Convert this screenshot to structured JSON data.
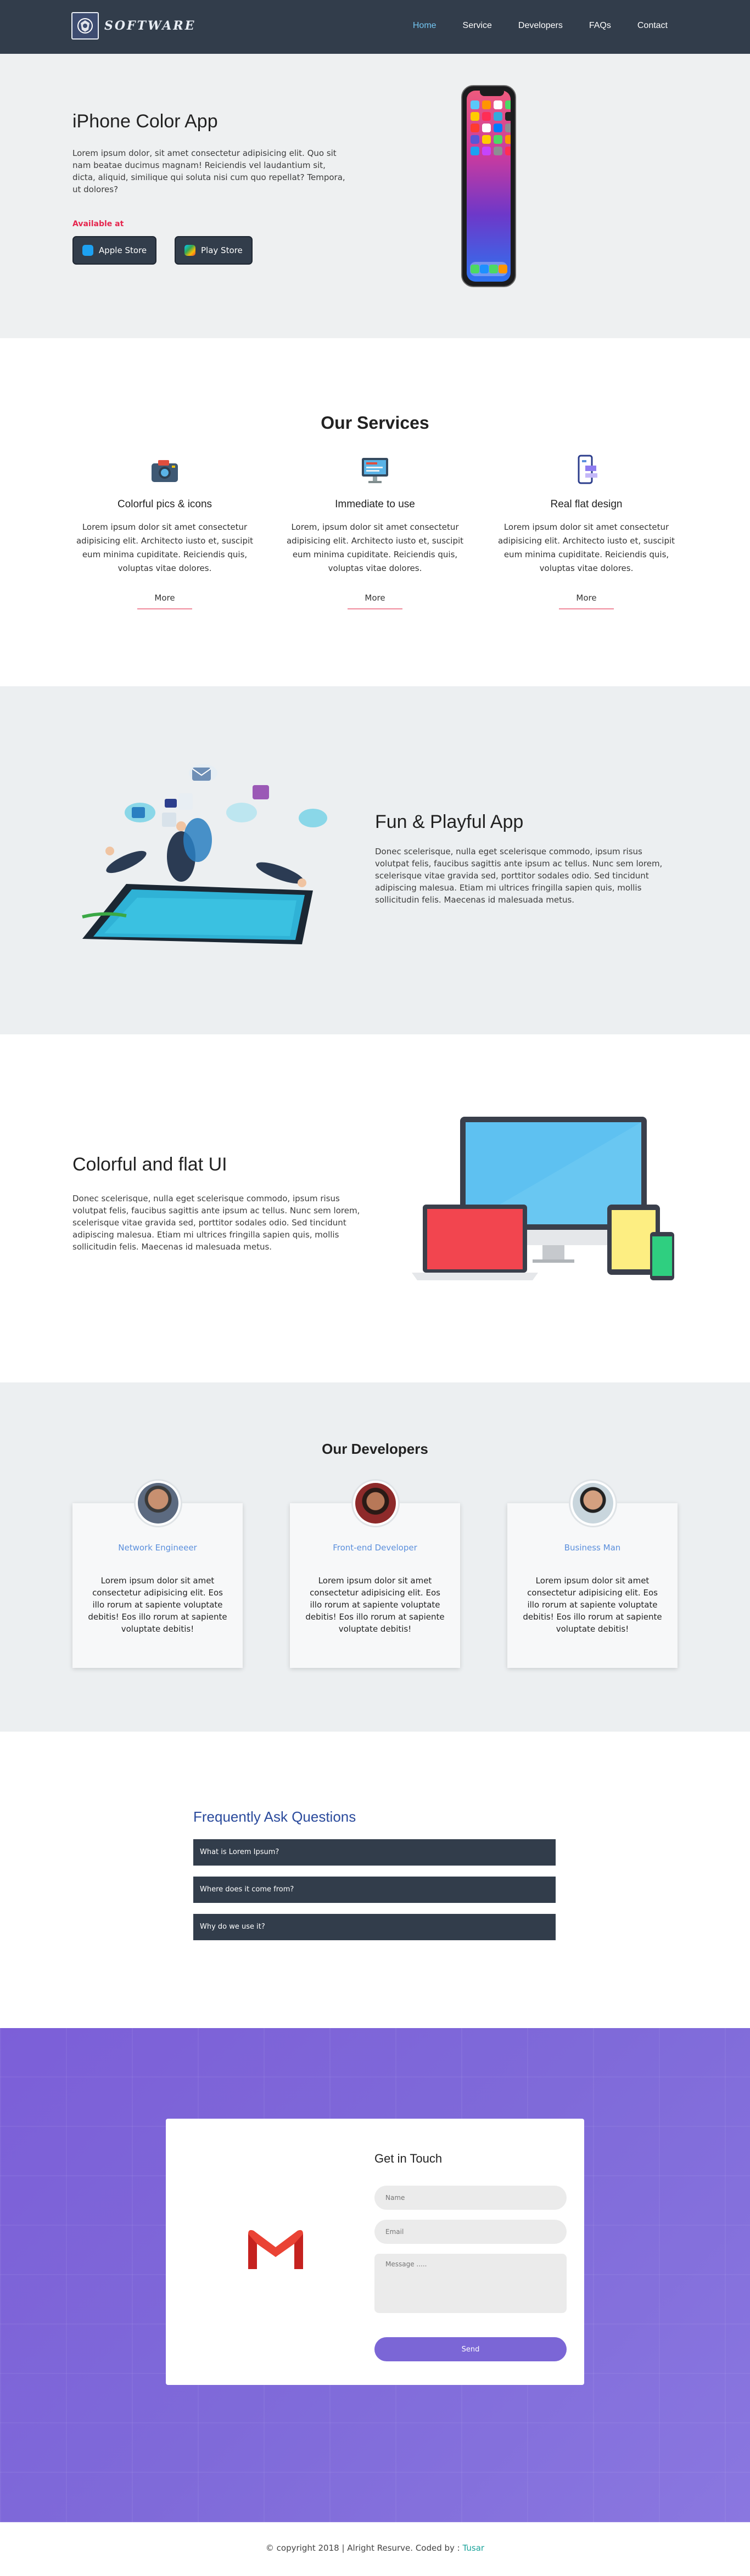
{
  "nav": {
    "logo_text": "SOFTWARE",
    "items": [
      {
        "label": "Home"
      },
      {
        "label": "Service"
      },
      {
        "label": "Developers"
      },
      {
        "label": "FAQs"
      },
      {
        "label": "Contact"
      }
    ]
  },
  "hero": {
    "title": "iPhone Color App",
    "text": "Lorem ipsum dolor, sit amet consectetur adipisicing elit. Quo sit nam beatae ducimus magnam! Reiciendis vel laudantium sit, dicta, aliquid, similique qui soluta nisi cum quo repellat? Tempora, ut dolores?",
    "available": "Available at",
    "apple_label": "Apple Store",
    "play_label": "Play Store"
  },
  "services": {
    "title": "Our Services",
    "items": [
      {
        "title": "Colorful pics & icons",
        "text": "Lorem ipsum dolor sit amet consectetur adipisicing elit. Architecto iusto et, suscipit eum minima cupiditate. Reiciendis quis, voluptas vitae dolores.",
        "more": "More"
      },
      {
        "title": "Immediate to use",
        "text": "Lorem, ipsum dolor sit amet consectetur adipisicing elit. Architecto iusto et, suscipit eum minima cupiditate. Reiciendis quis, voluptas vitae dolores.",
        "more": "More"
      },
      {
        "title": "Real flat design",
        "text": "Lorem ipsum dolor sit amet consectetur adipisicing elit. Architecto iusto et, suscipit eum minima cupiditate. Reiciendis quis, voluptas vitae dolores.",
        "more": "More"
      }
    ]
  },
  "fun": {
    "title": "Fun & Playful App",
    "text": "Donec scelerisque, nulla eget scelerisque commodo, ipsum risus volutpat felis, faucibus sagittis ante ipsum ac tellus. Nunc sem lorem, scelerisque vitae gravida sed, porttitor sodales odio. Sed tincidunt adipiscing malesua. Etiam mi ultrices fringilla sapien quis, mollis sollicitudin felis. Maecenas id malesuada metus."
  },
  "flat": {
    "title": "Colorful and flat UI",
    "text": "Donec scelerisque, nulla eget scelerisque commodo, ipsum risus volutpat felis, faucibus sagittis ante ipsum ac tellus. Nunc sem lorem, scelerisque vitae gravida sed, porttitor sodales odio. Sed tincidunt adipiscing malesua. Etiam mi ultrices fringilla sapien quis, mollis sollicitudin felis. Maecenas id malesuada metus."
  },
  "developers": {
    "title": "Our Developers",
    "items": [
      {
        "role": "Network Engineeer",
        "bio": "Lorem ipsum dolor sit amet consectetur adipisicing elit. Eos illo rorum at sapiente voluptate debitis! Eos illo rorum at sapiente voluptate debitis!"
      },
      {
        "role": "Front-end Developer",
        "bio": "Lorem ipsum dolor sit amet consectetur adipisicing elit. Eos illo rorum at sapiente voluptate debitis! Eos illo rorum at sapiente voluptate debitis!"
      },
      {
        "role": "Business Man",
        "bio": "Lorem ipsum dolor sit amet consectetur adipisicing elit. Eos illo rorum at sapiente voluptate debitis! Eos illo rorum at sapiente voluptate debitis!"
      }
    ]
  },
  "faq": {
    "title": "Frequently Ask Questions",
    "items": [
      {
        "q": "What is Lorem Ipsum?"
      },
      {
        "q": "Where does it come from?"
      },
      {
        "q": "Why do we use it?"
      }
    ]
  },
  "contact": {
    "title": "Get in Touch",
    "name_placeholder": "Name",
    "email_placeholder": "Email",
    "message_placeholder": "Message .....",
    "send_label": "Send"
  },
  "footer": {
    "text": "© copyright 2018 | Alright Resurve. Coded by :",
    "author": "Tusar"
  },
  "colors": {
    "nav_bg": "#323d4b",
    "nav_active": "#73c6f2",
    "accent_red": "#e5264e",
    "purple": "#7b66d6",
    "faq_title": "#2a4a9c",
    "dev_role": "#5b8fdc",
    "footer_link": "#1aa39a"
  }
}
